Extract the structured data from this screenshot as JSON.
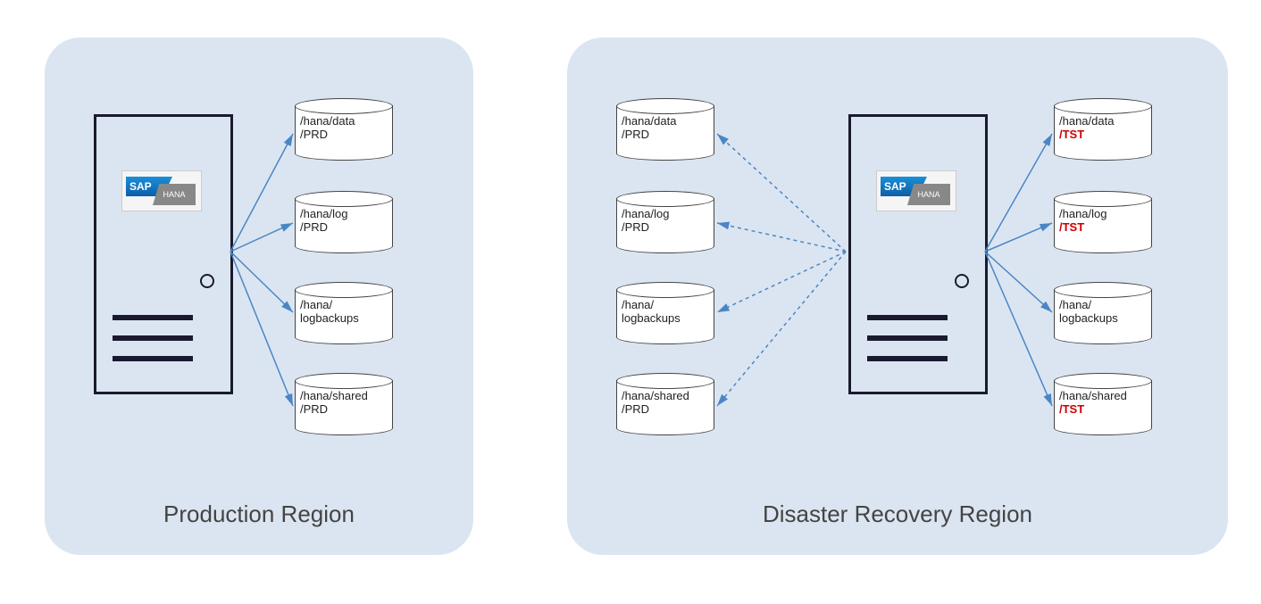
{
  "regions": {
    "production": {
      "label": "Production Region",
      "logo": {
        "sap": "SAP",
        "hana": "HANA"
      },
      "volumes": [
        {
          "line1": "/hana/data",
          "line2": "/PRD",
          "l2red": false
        },
        {
          "line1": "/hana/log",
          "line2": "/PRD",
          "l2red": false
        },
        {
          "line1": "/hana/",
          "line2": "logbackups",
          "l2red": false
        },
        {
          "line1": "/hana/shared",
          "line2": "/PRD",
          "l2red": false
        }
      ]
    },
    "dr": {
      "label": "Disaster Recovery Region",
      "logo": {
        "sap": "SAP",
        "hana": "HANA"
      },
      "left_volumes": [
        {
          "line1": "/hana/data",
          "line2": "/PRD",
          "l2red": false
        },
        {
          "line1": "/hana/log",
          "line2": "/PRD",
          "l2red": false
        },
        {
          "line1": "/hana/",
          "line2": "logbackups",
          "l2red": false
        },
        {
          "line1": "/hana/shared",
          "line2": "/PRD",
          "l2red": false
        }
      ],
      "right_volumes": [
        {
          "line1": "/hana/data",
          "line2": "/TST",
          "l2red": true
        },
        {
          "line1": "/hana/log",
          "line2": "/TST",
          "l2red": true
        },
        {
          "line1": "/hana/",
          "line2": "logbackups",
          "l2red": false
        },
        {
          "line1": "/hana/shared",
          "line2": "/TST",
          "l2red": true
        }
      ]
    }
  }
}
